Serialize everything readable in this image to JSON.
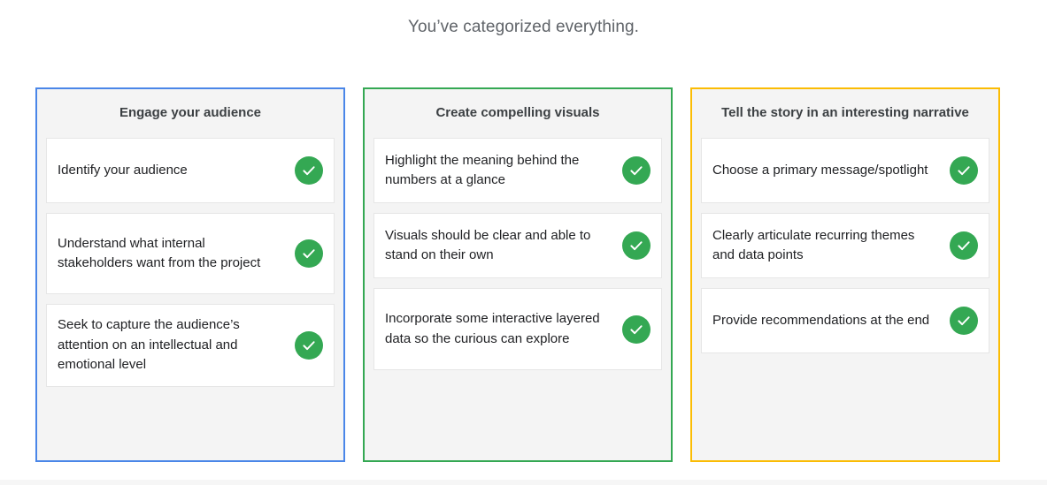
{
  "header": {
    "title": "You’ve categorized everything."
  },
  "colors": {
    "blue_border": "#4a86e8",
    "green_border": "#34a853",
    "yellow_border": "#fbbc04",
    "check": "#34a853"
  },
  "icons": {
    "card_status": "check-circle-icon"
  },
  "buckets": [
    {
      "title": "Engage your audience",
      "items": [
        "Identify your audience",
        "Understand what internal stakeholders want from the project",
        "Seek to capture the audience’s attention on an intellectual and emotional level"
      ]
    },
    {
      "title": "Create compelling visuals",
      "items": [
        "Highlight the meaning behind the numbers at a glance",
        "Visuals should be clear and able to stand on their own",
        "Incorporate some interactive layered data so the curious can explore"
      ]
    },
    {
      "title": "Tell the story in an interesting narrative",
      "items": [
        "Choose a primary message/spotlight",
        "Clearly articulate recurring themes and data points",
        "Provide recommendations at the end"
      ]
    }
  ]
}
